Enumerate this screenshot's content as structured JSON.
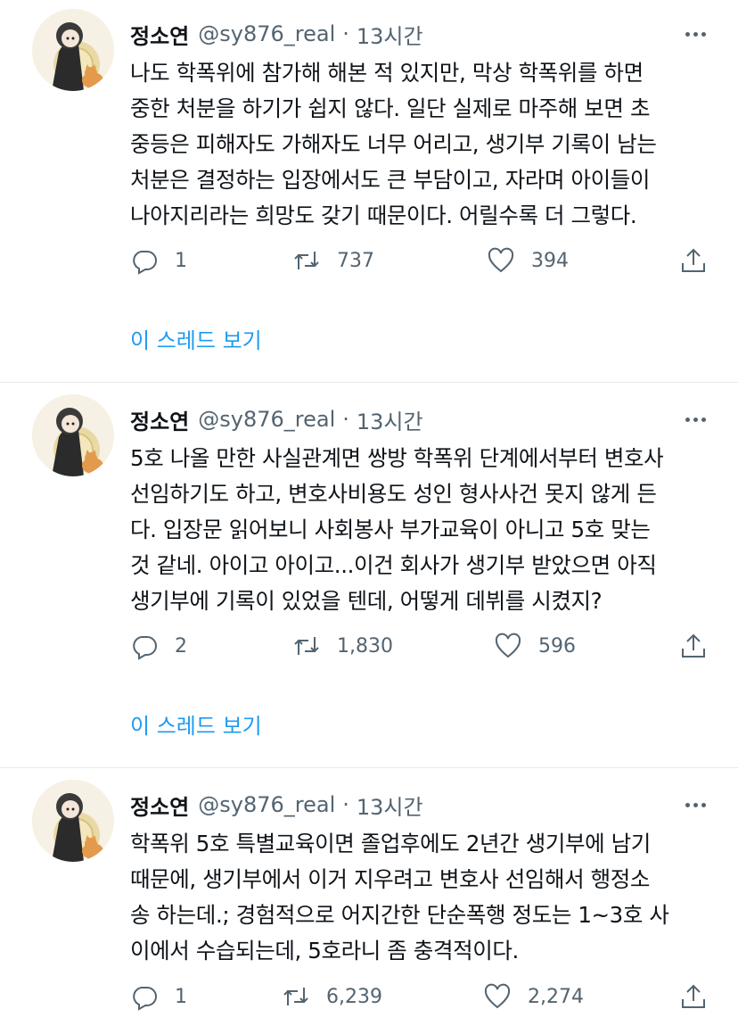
{
  "tweets": [
    {
      "name": "정소연",
      "handle": "@sy876_real",
      "separator": "·",
      "time": "13시간",
      "text": "나도 학폭위에 참가해 해본 적 있지만, 막상 학폭위를 하면\n중한 처분을 하기가 쉽지 않다. 일단 실제로 마주해 보면 초\n중등은 피해자도 가해자도 너무 어리고, 생기부 기록이 남는\n처분은 결정하는 입장에서도 큰 부담이고, 자라며 아이들이\n나아지리라는 희망도 갖기 때문이다. 어릴수록 더 그렇다.",
      "replies": "1",
      "retweets": "737",
      "likes": "394",
      "thread_link": "이 스레드 보기"
    },
    {
      "name": "정소연",
      "handle": "@sy876_real",
      "separator": "·",
      "time": "13시간",
      "text": "5호 나올 만한 사실관계면 쌍방 학폭위 단계에서부터 변호사\n선임하기도 하고, 변호사비용도 성인 형사사건 못지 않게 든\n다. 입장문 읽어보니 사회봉사 부가교육이 아니고 5호 맞는\n것 같네. 아이고 아이고...이건 회사가 생기부 받았으면 아직\n생기부에 기록이 있었을 텐데, 어떻게 데뷔를 시켰지?",
      "replies": "2",
      "retweets": "1,830",
      "likes": "596",
      "thread_link": "이 스레드 보기"
    },
    {
      "name": "정소연",
      "handle": "@sy876_real",
      "separator": "·",
      "time": "13시간",
      "text": "학폭위 5호 특별교육이면 졸업후에도 2년간 생기부에 남기\n때문에, 생기부에서 이거 지우려고 변호사 선임해서 행정소\n송 하는데.; 경험적으로 어지간한 단순폭행 정도는 1~3호 사\n이에서 수습되는데, 5호라니 좀 충격적이다.",
      "replies": "1",
      "retweets": "6,239",
      "likes": "2,274"
    }
  ],
  "icons": {
    "reply": "speech-bubble-icon",
    "retweet": "retweet-arrows-icon",
    "like": "heart-icon",
    "share": "share-upload-icon",
    "more": "more-dots-icon"
  },
  "colors": {
    "text": "#0f1419",
    "secondary": "#536471",
    "link": "#1d9bf0",
    "divider": "#e6e9eb"
  }
}
